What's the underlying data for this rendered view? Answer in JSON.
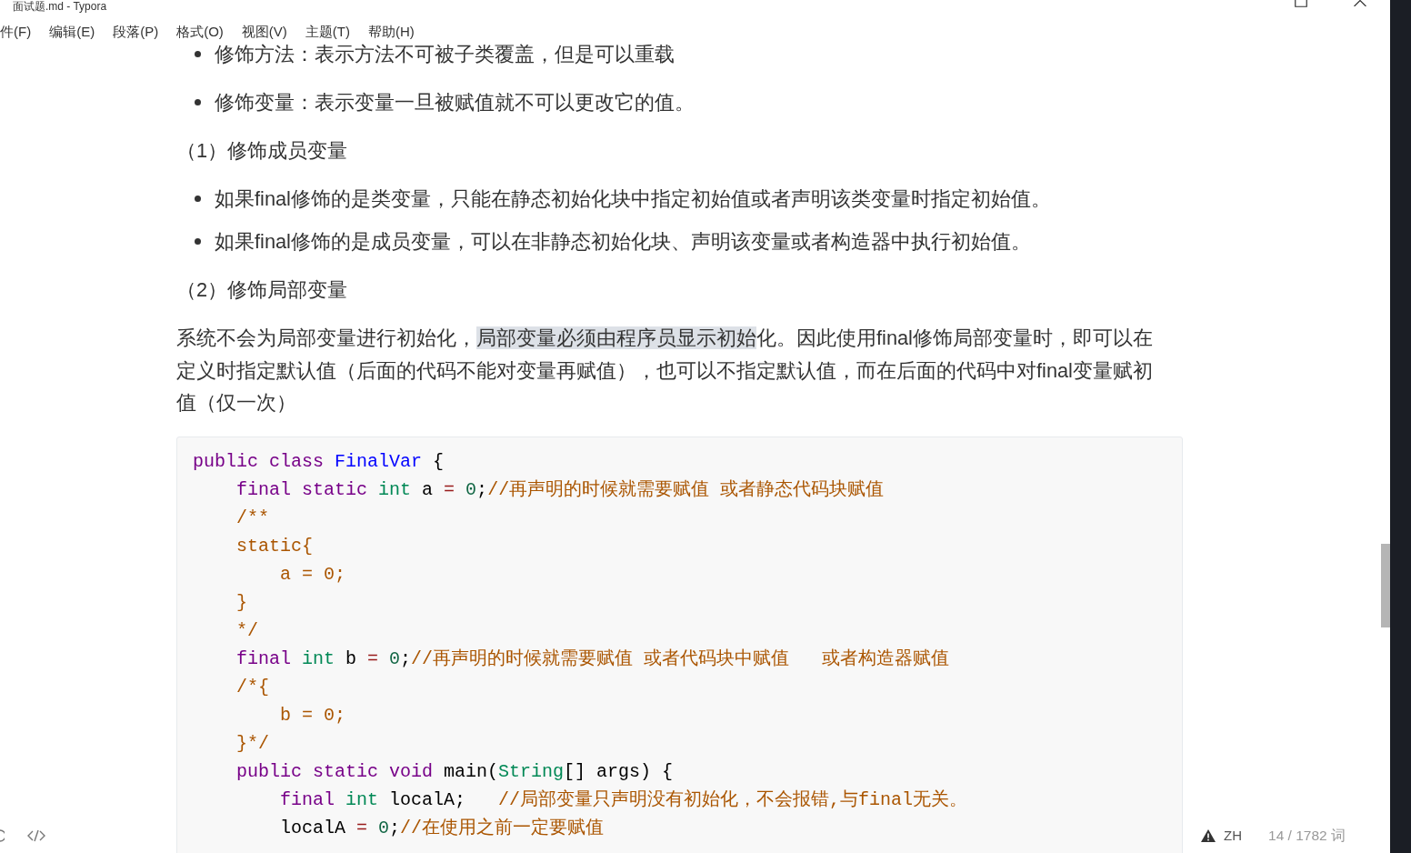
{
  "window": {
    "title": "面试题.md - Typora"
  },
  "menu": [
    "件(F)",
    "编辑(E)",
    "段落(P)",
    "格式(O)",
    "视图(V)",
    "主题(T)",
    "帮助(H)"
  ],
  "document": {
    "blocks": [
      {
        "kind": "bullet_list",
        "items": [
          "修饰方法：表示方法不可被子类覆盖，但是可以重载"
        ]
      },
      {
        "kind": "bullet_list",
        "items": [
          "修饰变量：表示变量一旦被赋值就不可以更改它的值。"
        ]
      },
      {
        "kind": "paragraph",
        "segments": [
          {
            "text": "（1）修饰成员变量",
            "selected": false
          }
        ]
      },
      {
        "kind": "bullet_list",
        "items": [
          "如果final修饰的是类变量，只能在静态初始化块中指定初始值或者声明该类变量时指定初始值。",
          "如果final修饰的是成员变量，可以在非静态初始化块、声明该变量或者构造器中执行初始值。"
        ]
      },
      {
        "kind": "paragraph",
        "segments": [
          {
            "text": "（2）修饰局部变量",
            "selected": false
          }
        ]
      },
      {
        "kind": "paragraph",
        "segments": [
          {
            "text": "系统不会为局部变量进行初始化，",
            "selected": false
          },
          {
            "text": "局部变量必须由程序员显示初始",
            "selected": true
          },
          {
            "text": "化。因此使用final修饰局部变量时，即可以在定义时指定默认值（后面的代码不能对变量再赋值），也可以不指定默认值，而在后面的代码中对final变量赋初值（仅一次）",
            "selected": false
          }
        ]
      },
      {
        "kind": "code",
        "lines": [
          {
            "tokens": [
              {
                "kind": "keyword",
                "text": "public "
              },
              {
                "kind": "keyword",
                "text": "class "
              },
              {
                "kind": "def",
                "text": "FinalVar"
              },
              {
                "kind": "plain",
                "text": " {"
              }
            ]
          },
          {
            "tokens": [
              {
                "kind": "keyword",
                "text": "    final "
              },
              {
                "kind": "keyword",
                "text": "static "
              },
              {
                "kind": "type",
                "text": "int"
              },
              {
                "kind": "plain",
                "text": " a "
              },
              {
                "kind": "operator",
                "text": "= "
              },
              {
                "kind": "number",
                "text": "0"
              },
              {
                "kind": "plain",
                "text": ";"
              },
              {
                "kind": "comment",
                "text": "//再声明的时候就需要赋值 或者静态代码块赋值"
              }
            ]
          },
          {
            "tokens": [
              {
                "kind": "comment",
                "text": "    /**"
              }
            ]
          },
          {
            "tokens": [
              {
                "kind": "comment",
                "text": "    static{"
              }
            ]
          },
          {
            "tokens": [
              {
                "kind": "comment",
                "text": "        a = 0;"
              }
            ]
          },
          {
            "tokens": [
              {
                "kind": "comment",
                "text": "    }"
              }
            ]
          },
          {
            "tokens": [
              {
                "kind": "comment",
                "text": "    */"
              }
            ]
          },
          {
            "tokens": [
              {
                "kind": "keyword",
                "text": "    final "
              },
              {
                "kind": "type",
                "text": "int"
              },
              {
                "kind": "plain",
                "text": " b "
              },
              {
                "kind": "operator",
                "text": "= "
              },
              {
                "kind": "number",
                "text": "0"
              },
              {
                "kind": "plain",
                "text": ";"
              },
              {
                "kind": "comment",
                "text": "//再声明的时候就需要赋值 或者代码块中赋值   或者构造器赋值"
              }
            ]
          },
          {
            "tokens": [
              {
                "kind": "comment",
                "text": "    /*{"
              }
            ]
          },
          {
            "tokens": [
              {
                "kind": "comment",
                "text": "        b = 0;"
              }
            ]
          },
          {
            "tokens": [
              {
                "kind": "comment",
                "text": "    }*/"
              }
            ]
          },
          {
            "tokens": [
              {
                "kind": "keyword",
                "text": "    public "
              },
              {
                "kind": "keyword",
                "text": "static "
              },
              {
                "kind": "keyword",
                "text": "void"
              },
              {
                "kind": "plain",
                "text": " main("
              },
              {
                "kind": "type",
                "text": "String"
              },
              {
                "kind": "plain",
                "text": "[] args) {"
              }
            ]
          },
          {
            "tokens": [
              {
                "kind": "keyword",
                "text": "        final "
              },
              {
                "kind": "type",
                "text": "int"
              },
              {
                "kind": "plain",
                "text": " localA;   "
              },
              {
                "kind": "comment",
                "text": "//局部变量只声明没有初始化，不会报错,与final无关。"
              }
            ]
          },
          {
            "tokens": [
              {
                "kind": "plain",
                "text": "        localA "
              },
              {
                "kind": "operator",
                "text": "= "
              },
              {
                "kind": "number",
                "text": "0"
              },
              {
                "kind": "plain",
                "text": ";"
              },
              {
                "kind": "comment",
                "text": "//在使用之前一定要赋值"
              }
            ]
          }
        ]
      }
    ]
  },
  "status_bar": {
    "language": "ZH",
    "word_count": "14 / 1782 词"
  }
}
